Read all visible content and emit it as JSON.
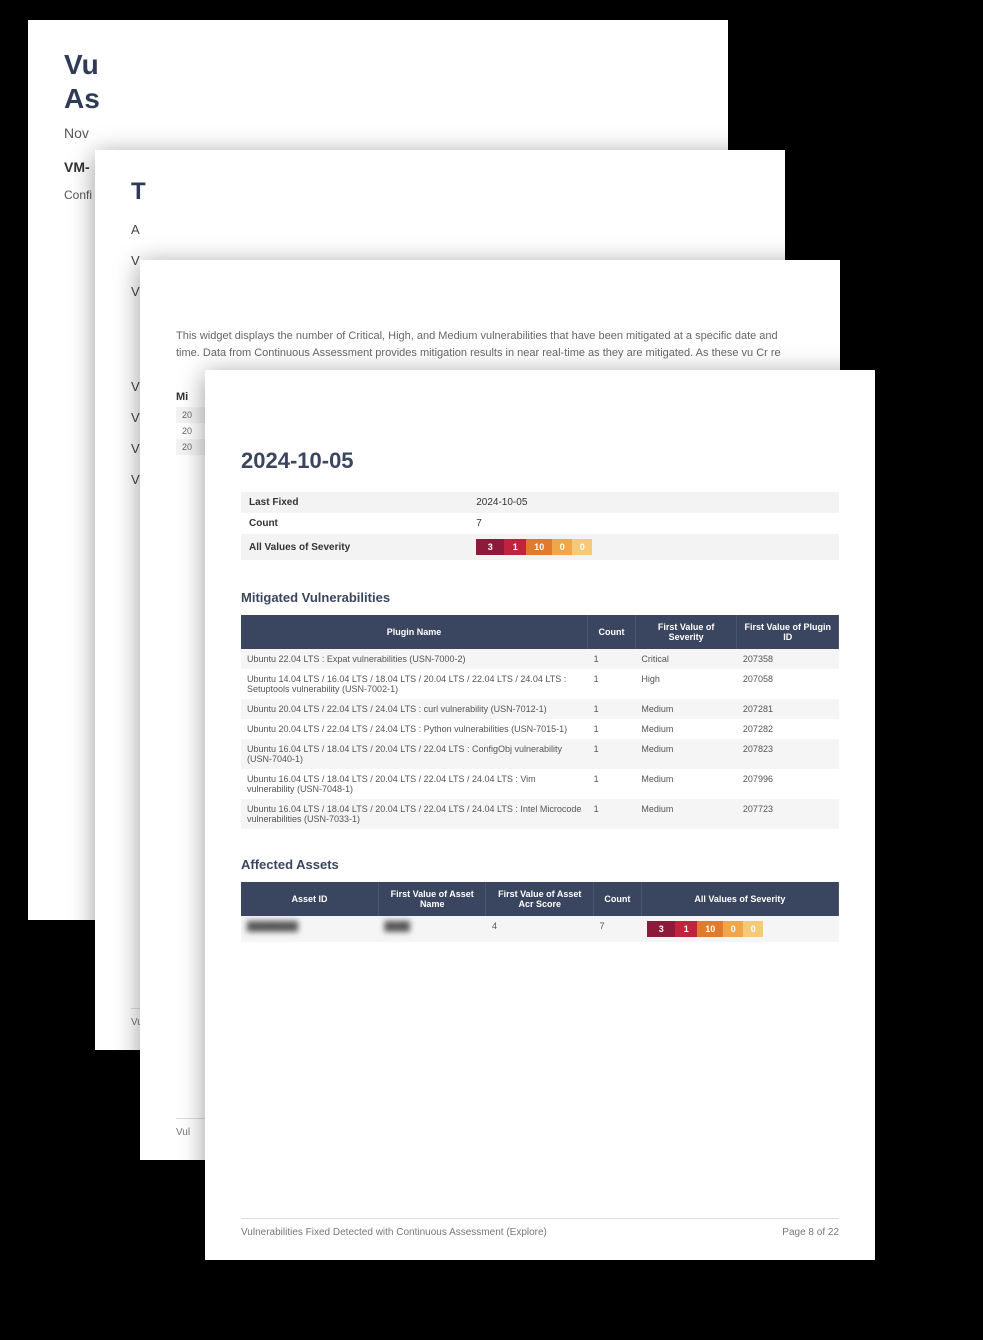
{
  "page1": {
    "title_line1": "Vu",
    "title_line2": "As",
    "date": "Nov",
    "bold": "VM-",
    "desc": "Confi\nyour"
  },
  "page2": {
    "toc_title": "T",
    "items": [
      "A",
      "V",
      "V",
      "V",
      "V",
      "V",
      "V"
    ],
    "footer": "Vul"
  },
  "page3": {
    "desc": "This widget displays the number of Critical, High, and Medium vulnerabilities that have been mitigated at a specific date and time. Data from Continuous Assessment provides mitigation results in near real-time as they are mitigated. As these vu\nCr\nre",
    "mit_chapter": "Mi",
    "rows": [
      "20",
      "20",
      "20"
    ],
    "footer": "Vul"
  },
  "page4": {
    "date_heading": "2024-10-05",
    "kv": [
      {
        "k": "Last Fixed",
        "v": "2024-10-05"
      },
      {
        "k": "Count",
        "v": "7"
      },
      {
        "k": "All Values of Severity",
        "v": "__severity_bar__"
      }
    ],
    "sev_bar": [
      "3",
      "1",
      "10",
      "0",
      "0"
    ],
    "mit_title": "Mitigated Vulnerabilities",
    "mit_headers": [
      "Plugin Name",
      "Count",
      "First Value of Severity",
      "First Value of Plugin ID"
    ],
    "mit_rows": [
      {
        "name": "Ubuntu 22.04 LTS : Expat vulnerabilities (USN-7000-2)",
        "count": "1",
        "sev": "Critical",
        "sevcls": "sev-critical-txt",
        "pid": "207358"
      },
      {
        "name": "Ubuntu 14.04 LTS / 16.04 LTS / 18.04 LTS / 20.04 LTS / 22.04 LTS / 24.04 LTS : Setuptools vulnerability (USN-7002-1)",
        "count": "1",
        "sev": "High",
        "sevcls": "sev-high-txt",
        "pid": "207058"
      },
      {
        "name": "Ubuntu 20.04 LTS / 22.04 LTS / 24.04 LTS : curl vulnerability (USN-7012-1)",
        "count": "1",
        "sev": "Medium",
        "sevcls": "sev-medium-txt",
        "pid": "207281"
      },
      {
        "name": "Ubuntu 20.04 LTS / 22.04 LTS / 24.04 LTS : Python vulnerabilities (USN-7015-1)",
        "count": "1",
        "sev": "Medium",
        "sevcls": "sev-medium-txt",
        "pid": "207282"
      },
      {
        "name": "Ubuntu 16.04 LTS / 18.04 LTS / 20.04 LTS / 22.04 LTS : ConfigObj vulnerability (USN-7040-1)",
        "count": "1",
        "sev": "Medium",
        "sevcls": "sev-medium-txt",
        "pid": "207823"
      },
      {
        "name": "Ubuntu 16.04 LTS / 18.04 LTS / 20.04 LTS / 22.04 LTS / 24.04 LTS : Vim vulnerability (USN-7048-1)",
        "count": "1",
        "sev": "Medium",
        "sevcls": "sev-medium-txt",
        "pid": "207996"
      },
      {
        "name": "Ubuntu 16.04 LTS / 18.04 LTS / 20.04 LTS / 22.04 LTS / 24.04 LTS : Intel Microcode vulnerabilities (USN-7033-1)",
        "count": "1",
        "sev": "Medium",
        "sevcls": "sev-medium-txt",
        "pid": "207723"
      }
    ],
    "assets_title": "Affected Assets",
    "assets_headers": [
      "Asset ID",
      "First Value of Asset Name",
      "First Value of Asset Acr Score",
      "Count",
      "All Values of Severity"
    ],
    "assets_rows": [
      {
        "id": " ",
        "name": " ",
        "score": "4",
        "count": "7",
        "sev_bar": [
          "3",
          "1",
          "10",
          "0",
          "0"
        ]
      }
    ],
    "footer_left": "Vulnerabilities Fixed Detected with Continuous Assessment (Explore)",
    "footer_right": "Page 8 of 22"
  }
}
